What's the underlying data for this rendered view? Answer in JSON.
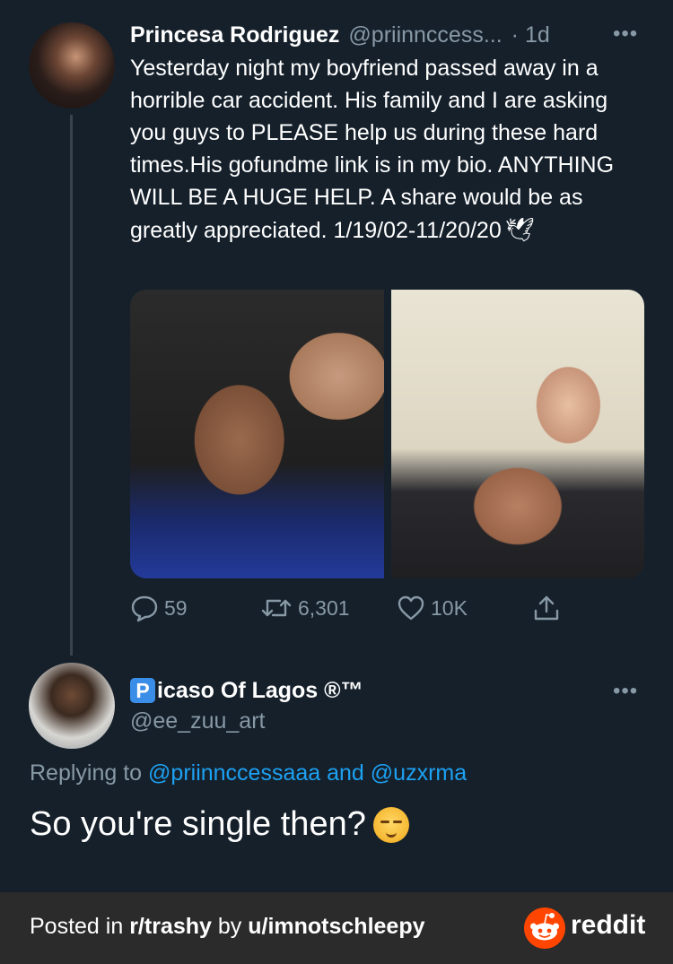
{
  "tweet": {
    "author_name": "Princesa Rodriguez",
    "author_handle": "@priinnccess...",
    "time": "· 1d",
    "more": "•••",
    "text": "Yesterday night my boyfriend passed away in a horrible car accident. His family and I are asking you guys to PLEASE help us during these hard times.His gofundme link is in my bio. ANYTHING WILL BE A HUGE HELP. A share would be as greatly appreciated. 1/19/02-11/20/20",
    "text_emoji": "🕊",
    "actions": {
      "replies": "59",
      "retweets": "6,301",
      "likes": "10K"
    }
  },
  "reply": {
    "author_badge": "P",
    "author_name_rest": "icaso Of Lagos ®™",
    "author_handle": "@ee_zuu_art",
    "more": "•••",
    "replying_prefix": "Replying to",
    "replying_mention1": "@priinnccessaaa",
    "replying_and": "and",
    "replying_mention2": "@uzxrma",
    "text": "So you're single then?"
  },
  "footer": {
    "posted_in": "Posted in",
    "subreddit": "r/trashy",
    "by": "by",
    "user": "u/imnotschleepy",
    "brand": "reddit"
  },
  "colors": {
    "background": "#15202b",
    "secondary_text": "#8899a6",
    "link": "#1da1f2",
    "footer_bg": "#2b2b2b",
    "reddit_orange": "#ff4500"
  },
  "icons": [
    "reply-icon",
    "retweet-icon",
    "like-icon",
    "share-icon",
    "reddit-logo-icon",
    "dove-emoji",
    "relieved-face-emoji"
  ]
}
